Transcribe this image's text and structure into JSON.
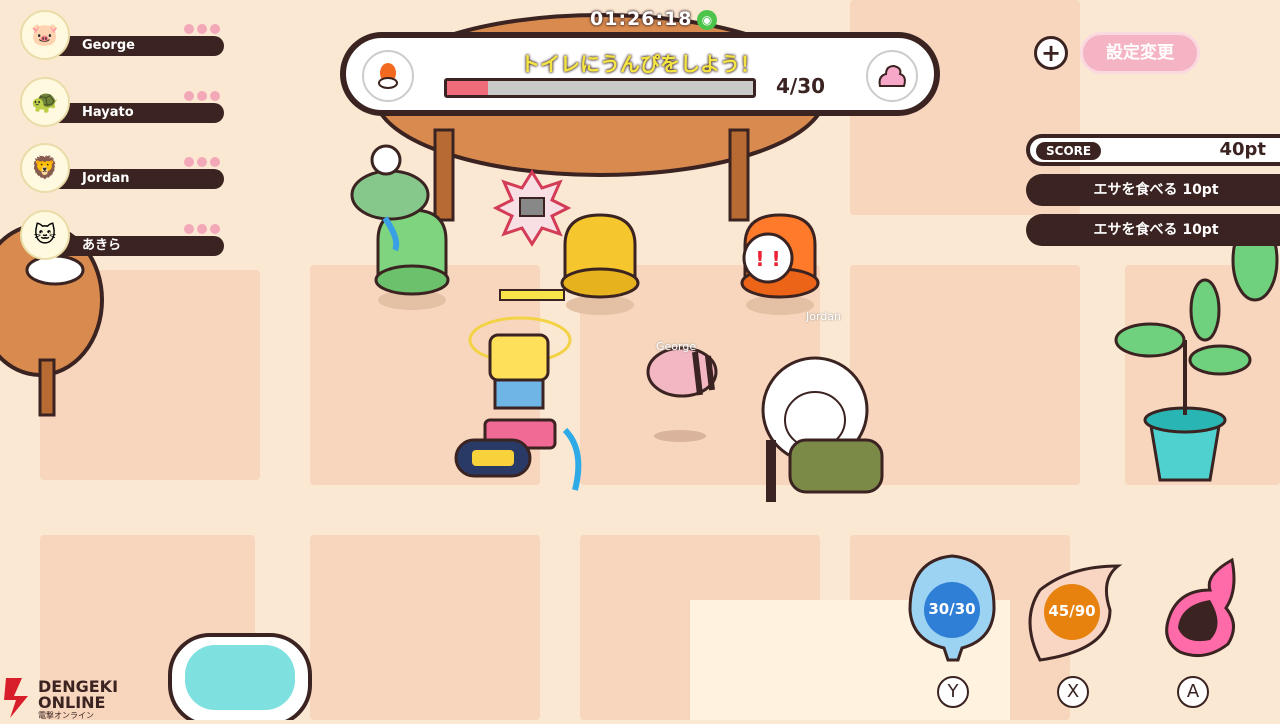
{
  "clock": "01:26:18",
  "players": [
    {
      "name": "George",
      "avatar": "🐷"
    },
    {
      "name": "Hayato",
      "avatar": "🐢"
    },
    {
      "name": "Jordan",
      "avatar": "🦁"
    },
    {
      "name": "あきら",
      "avatar": "🐱"
    }
  ],
  "quest": {
    "title": "トイレにうんぴをしよう！",
    "progress": "4/30",
    "progress_fraction": 0.133,
    "left_icon": "toilet-icon",
    "right_icon": "poop-icon"
  },
  "settings_label": "設定変更",
  "score": {
    "label": "SCORE",
    "value": "40pt"
  },
  "log": [
    "エサを食べる 10pt",
    "エサを食べる 10pt"
  ],
  "actions": [
    {
      "key": "Y",
      "value": "30/30",
      "icon": "water-drop-icon",
      "color": "#2f7fd6"
    },
    {
      "key": "X",
      "value": "45/90",
      "icon": "leaf-icon",
      "color": "#e8820f"
    },
    {
      "key": "A",
      "value": "",
      "icon": "fire-icon",
      "color": "#f04a8a"
    }
  ],
  "nametags": [
    "George",
    "Jordan"
  ],
  "logo": {
    "line1": "DENGEKI",
    "line2": "ONLINE",
    "line3": "電撃オンライン"
  }
}
